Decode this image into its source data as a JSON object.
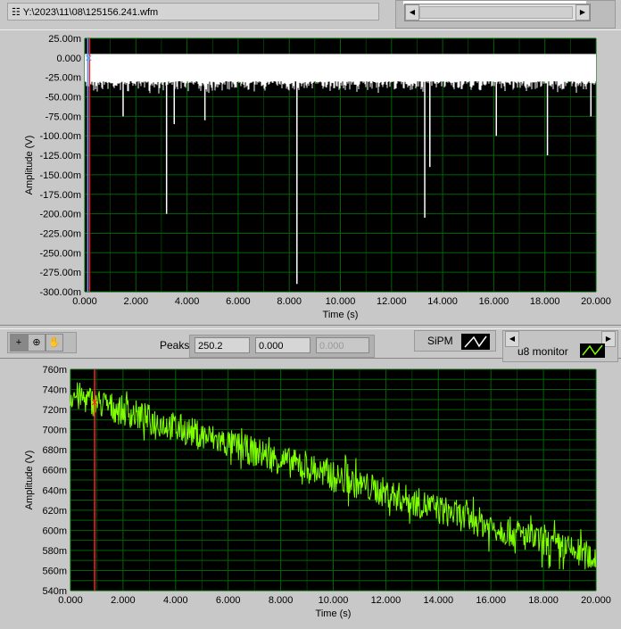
{
  "file_path": "Y:\\2023\\11\\08\\125156.241.wfm",
  "toolbar": {
    "peaks_label": "Peaks",
    "peak_values": [
      "250.2",
      "0.000",
      "0.000"
    ],
    "legend_sipm": "SiPM",
    "legend_u8": "u8 monitor"
  },
  "chart_data": [
    {
      "type": "line",
      "name": "SiPM",
      "xlabel": "Time (s)",
      "ylabel": "Amplitude (V)",
      "xlim": [
        0,
        20
      ],
      "ylim": [
        -0.3,
        0.025
      ],
      "xticks": [
        "0.000",
        "2.000",
        "4.000",
        "6.000",
        "8.000",
        "10.000",
        "12.000",
        "14.000",
        "16.000",
        "18.000",
        "20.000"
      ],
      "yticks": [
        "25.00m",
        "0.000",
        "-25.00m",
        "-50.00m",
        "-75.00m",
        "-100.00m",
        "-125.00m",
        "-150.00m",
        "-175.00m",
        "-200.00m",
        "-225.00m",
        "-250.00m",
        "-275.00m",
        "-300.00m"
      ],
      "baseline_band": [
        -0.03,
        0.005
      ],
      "spikes": [
        [
          1.5,
          -0.075
        ],
        [
          3.2,
          -0.2
        ],
        [
          3.5,
          -0.085
        ],
        [
          4.7,
          -0.08
        ],
        [
          8.3,
          -0.29
        ],
        [
          13.3,
          -0.205
        ],
        [
          13.5,
          -0.14
        ],
        [
          16.1,
          -0.1
        ],
        [
          18.1,
          -0.125
        ],
        [
          19.8,
          -0.075
        ]
      ],
      "cursor_x": 0.15,
      "line_color": "#ffffff",
      "grid_color": "#006400",
      "background": "#000000"
    },
    {
      "type": "line",
      "name": "u8 monitor",
      "xlabel": "Time (s)",
      "ylabel": "Amplitude (V)",
      "xlim": [
        0,
        20
      ],
      "ylim": [
        0.54,
        0.76
      ],
      "xticks": [
        "0.000",
        "2.000",
        "4.000",
        "6.000",
        "8.000",
        "10.000",
        "12.000",
        "14.000",
        "16.000",
        "18.000",
        "20.000"
      ],
      "yticks": [
        "760m",
        "740m",
        "720m",
        "700m",
        "680m",
        "660m",
        "640m",
        "620m",
        "600m",
        "580m",
        "560m",
        "540m"
      ],
      "trend_start": 0.735,
      "trend_end": 0.572,
      "noise": 0.015,
      "cursor_x": 0.92,
      "line_color": "#7fff00",
      "grid_color": "#006400",
      "background": "#000000"
    }
  ]
}
